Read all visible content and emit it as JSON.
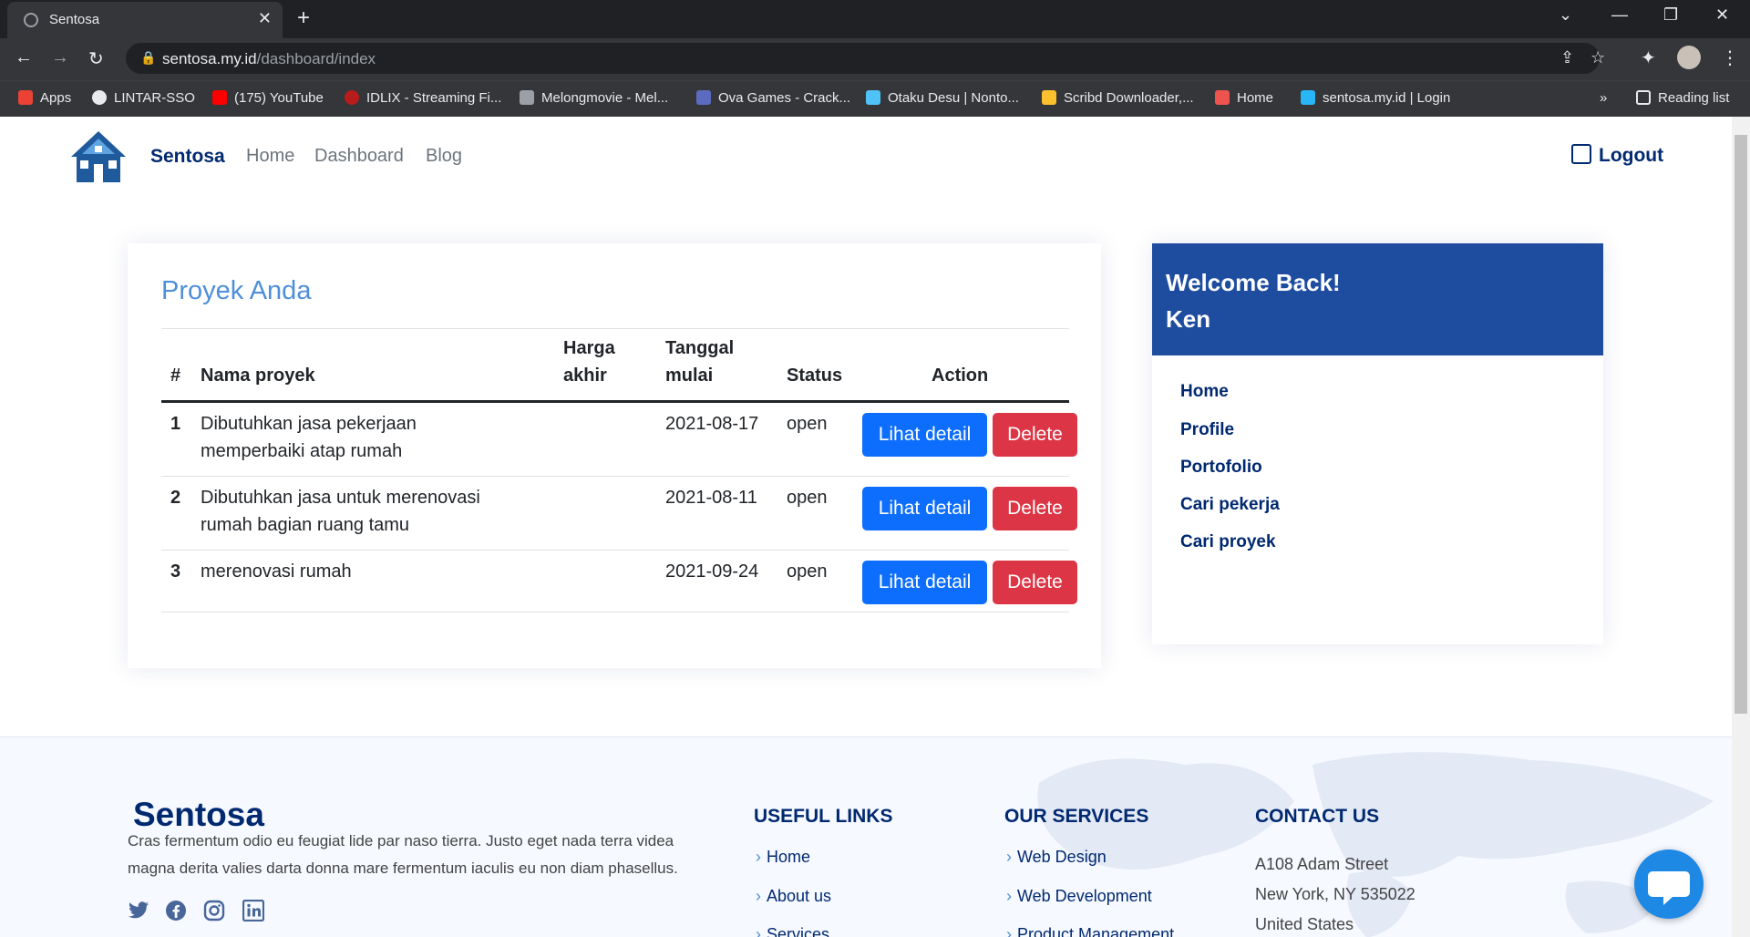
{
  "browser": {
    "tab_title": "Sentosa",
    "url_host": "sentosa.my.id",
    "url_path": "/dashboard/index",
    "bookmarks": [
      {
        "label": "Apps",
        "color": "#ea4335"
      },
      {
        "label": "LINTAR-SSO",
        "color": "#e8eaed"
      },
      {
        "label": "(175) YouTube",
        "color": "#ff0000"
      },
      {
        "label": "IDLIX - Streaming Fi...",
        "color": "#b71c1c"
      },
      {
        "label": "Melongmovie - Mel...",
        "color": "#9aa0a6"
      },
      {
        "label": "Ova Games - Crack...",
        "color": "#5c6bc0"
      },
      {
        "label": "Otaku Desu | Nonto...",
        "color": "#4fc3f7"
      },
      {
        "label": "Scribd Downloader,...",
        "color": "#fbc02d"
      },
      {
        "label": "Home",
        "color": "#ef5350"
      },
      {
        "label": "sentosa.my.id | Login",
        "color": "#29b6f6"
      }
    ],
    "more": "»",
    "reading_list": "Reading list"
  },
  "navbar": {
    "brand": "Sentosa",
    "links": [
      "Home",
      "Dashboard",
      "Blog"
    ],
    "logout": "Logout"
  },
  "projects": {
    "title": "Proyek Anda",
    "headers": {
      "num": "#",
      "name": "Nama proyek",
      "price_1": "Harga",
      "price_2": "akhir",
      "date_1": "Tanggal",
      "date_2": "mulai",
      "status": "Status",
      "action": "Action"
    },
    "rows": [
      {
        "num": "1",
        "name_1": "Dibutuhkan jasa pekerjaan",
        "name_2": "memperbaiki atap rumah",
        "price": "",
        "date": "2021-08-17",
        "status": "open"
      },
      {
        "num": "2",
        "name_1": "Dibutuhkan jasa untuk merenovasi",
        "name_2": "rumah bagian ruang tamu",
        "price": "",
        "date": "2021-08-11",
        "status": "open"
      },
      {
        "num": "3",
        "name_1": "merenovasi rumah",
        "name_2": "",
        "price": "",
        "date": "2021-09-24",
        "status": "open"
      }
    ],
    "detail_label": "Lihat detail",
    "delete_label": "Delete"
  },
  "sidebar": {
    "welcome": "Welcome Back!",
    "user": "Ken",
    "links": [
      "Home",
      "Profile",
      "Portofolio",
      "Cari pekerja",
      "Cari proyek"
    ]
  },
  "footer": {
    "brand": "Sentosa",
    "description": "Cras fermentum odio eu feugiat lide par naso tierra. Justo eget nada terra videa magna derita valies darta donna mare fermentum iaculis eu non diam phasellus.",
    "useful_links_title": "USEFUL LINKS",
    "useful_links": [
      "Home",
      "About us",
      "Services"
    ],
    "services_title": "OUR SERVICES",
    "services": [
      "Web Design",
      "Web Development",
      "Product Management"
    ],
    "contact_title": "CONTACT US",
    "contact": [
      "A108 Adam Street",
      "New York, NY 535022",
      "United States"
    ]
  }
}
